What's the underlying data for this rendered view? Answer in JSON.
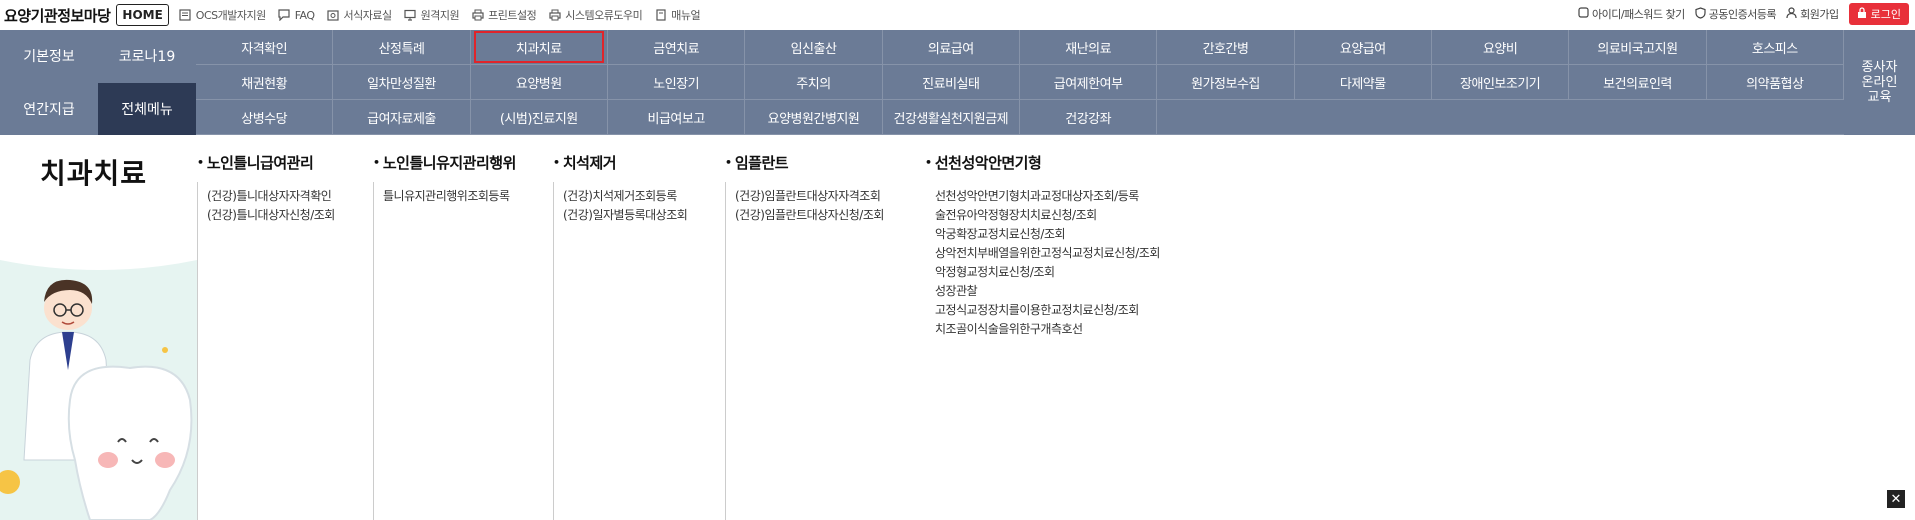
{
  "header": {
    "brand": "요양기관정보마당",
    "home_label": "HOME",
    "links": [
      {
        "label": "OCS개발자지원",
        "icon": "document-icon"
      },
      {
        "label": "FAQ",
        "icon": "chat-icon"
      },
      {
        "label": "서식자료실",
        "icon": "folder-icon"
      },
      {
        "label": "원격지원",
        "icon": "monitor-icon"
      },
      {
        "label": "프린트설정",
        "icon": "printer-icon"
      },
      {
        "label": "시스템오류도우미",
        "icon": "printer-icon"
      },
      {
        "label": "매뉴얼",
        "icon": "manual-icon"
      }
    ],
    "right_links": [
      {
        "label": "아이디/패스워드 찾기"
      },
      {
        "label": "공동인증서등록"
      },
      {
        "label": "회원가입"
      }
    ],
    "login_label": "로그인"
  },
  "nav": {
    "left": [
      "기본정보",
      "코로나19",
      "연간지급",
      "전체메뉴"
    ],
    "rows": [
      [
        "자격확인",
        "산정특례",
        "치과치료",
        "금연치료",
        "임신출산",
        "의료급여",
        "재난의료",
        "간호간병",
        "요양급여",
        "요양비",
        "의료비국고지원",
        "호스피스"
      ],
      [
        "채권현황",
        "일차만성질환",
        "요양병원",
        "노인장기",
        "주치의",
        "진료비실태",
        "급여제한여부",
        "원가정보수집",
        "다제약물",
        "장애인보조기기",
        "보건의료인력",
        "의약품협상"
      ],
      [
        "상병수당",
        "급여자료제출",
        "(시범)진료지원",
        "비급여보고",
        "요양병원간병지원",
        "건강생활실천지원금제",
        "건강강좌",
        "",
        "",
        "",
        "",
        ""
      ]
    ],
    "right": "종사자\n온라인\n교육",
    "selected": "치과치료"
  },
  "content": {
    "title": "치과치료",
    "columns": [
      {
        "head": "노인틀니급여관리",
        "items": [
          "(건강)틀니대상자자격확인",
          "(건강)틀니대상자신청/조회"
        ]
      },
      {
        "head": "노인틀니유지관리행위",
        "items": [
          "틀니유지관리행위조회등록"
        ]
      },
      {
        "head": "치석제거",
        "items": [
          "(건강)치석제거조회등록",
          "(건강)일자별등록대상조회"
        ]
      },
      {
        "head": "임플란트",
        "items": [
          "(건강)임플란트대상자자격조회",
          "(건강)임플란트대상자신청/조회"
        ]
      },
      {
        "head": "선천성악안면기형",
        "items": [
          "선천성악안면기형치과교정대상자조회/등록",
          "술전유아악정형장치치료신청/조회",
          "악궁확장교정치료신청/조회",
          "상악전치부배열을위한고정식교정치료신청/조회",
          "악정형교정치료신청/조회",
          "성장관찰",
          "고정식교정장치를이용한교정치료신청/조회",
          "치조골이식술을위한구개측호선"
        ]
      }
    ]
  },
  "colors": {
    "nav_bg": "#6b7b96",
    "nav_active": "#2d3a55",
    "login": "#e8303a",
    "highlight": "#e0242a"
  }
}
